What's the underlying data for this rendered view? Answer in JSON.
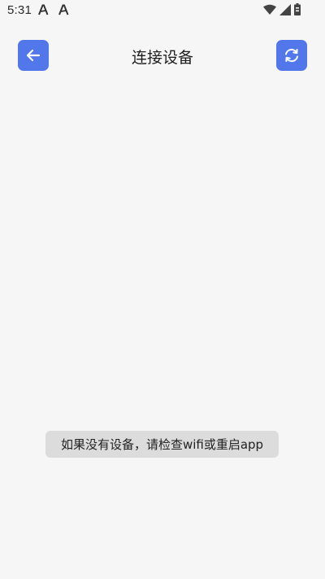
{
  "status_bar": {
    "time": "5:31",
    "notification_icons": [
      "font-a-icon",
      "font-a-icon"
    ],
    "right_icons": [
      "wifi-icon",
      "cell-signal-icon",
      "battery-icon"
    ]
  },
  "header": {
    "title": "连接设备",
    "back_icon": "arrow-left-icon",
    "refresh_icon": "refresh-icon"
  },
  "toast": {
    "message": "如果没有设备，请检查wifi或重启app"
  },
  "colors": {
    "accent": "#5277ea",
    "background": "#f6f6f6",
    "toast_bg": "#dcdcdc"
  }
}
